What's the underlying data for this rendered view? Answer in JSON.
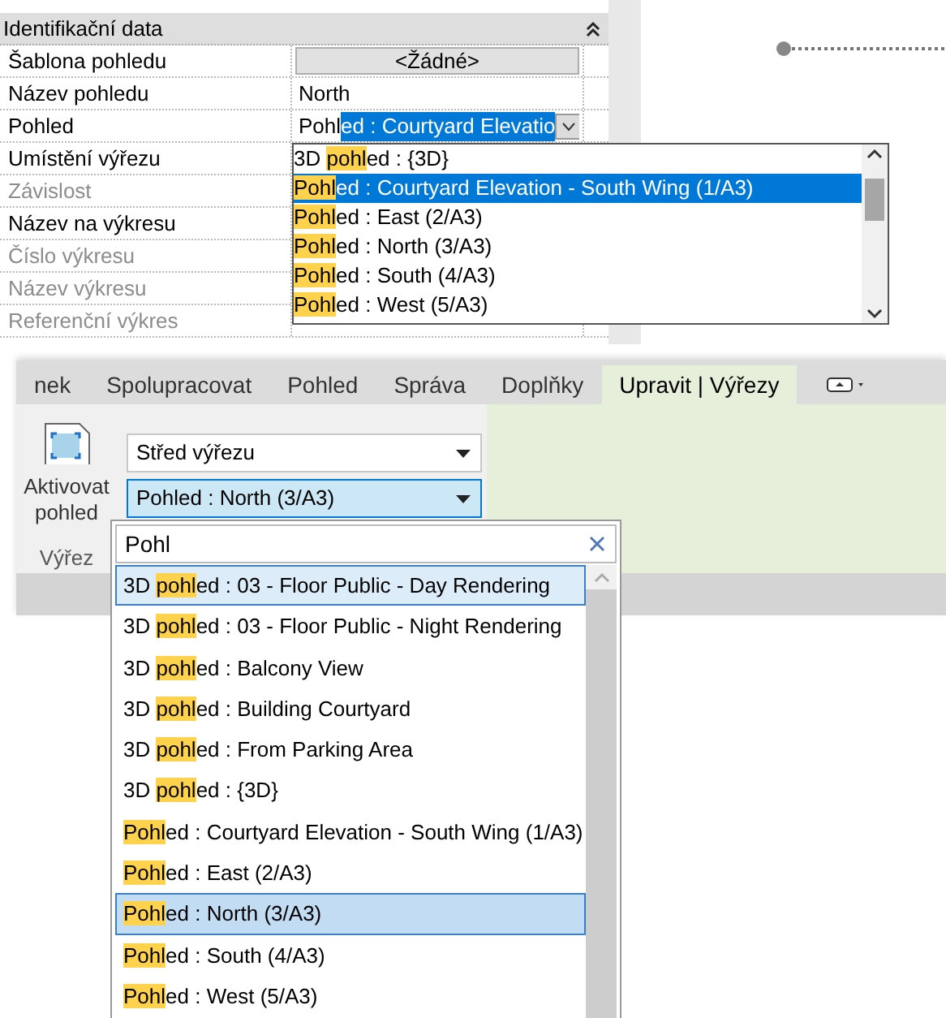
{
  "properties": {
    "section_title": "Identifikační data",
    "expanded": true,
    "rows": [
      {
        "label": "Šablona pohledu",
        "kind": "button",
        "value": "<Žádné>",
        "disabled": false
      },
      {
        "label": "Název pohledu",
        "kind": "text",
        "value": "North",
        "disabled": false
      },
      {
        "label": "Pohled",
        "kind": "combo",
        "value_before": "Pohl",
        "value_selected": "ed : Courtyard Elevatio",
        "disabled": false
      },
      {
        "label": "Umístění výřezu",
        "kind": "empty",
        "disabled": false
      },
      {
        "label": "Závislost",
        "kind": "empty",
        "disabled": true
      },
      {
        "label": "Název na výkresu",
        "kind": "empty",
        "disabled": false
      },
      {
        "label": "Číslo výkresu",
        "kind": "empty",
        "disabled": true
      },
      {
        "label": "Název výkresu",
        "kind": "empty",
        "disabled": true
      },
      {
        "label": "Referenční výkres",
        "kind": "empty",
        "disabled": true
      }
    ]
  },
  "property_dropdown": {
    "items": [
      {
        "before": "3D ",
        "match": "pohl",
        "after": "ed : {3D}",
        "selected": false
      },
      {
        "match": "Pohl",
        "after": "ed : Courtyard Elevation - South Wing (1/A3)",
        "selected": true
      },
      {
        "match": "Pohl",
        "after": "ed : East (2/A3)",
        "selected": false
      },
      {
        "match": "Pohl",
        "after": "ed : North (3/A3)",
        "selected": false
      },
      {
        "match": "Pohl",
        "after": "ed : South (4/A3)",
        "selected": false
      },
      {
        "match": "Pohl",
        "after": "ed : West (5/A3)",
        "selected": false
      }
    ]
  },
  "ribbon": {
    "tabs": [
      {
        "label": "nek",
        "selected": false
      },
      {
        "label": "Spolupracovat",
        "selected": false
      },
      {
        "label": "Pohled",
        "selected": false
      },
      {
        "label": "Správa",
        "selected": false
      },
      {
        "label": "Doplňky",
        "selected": false
      },
      {
        "label": "Upravit | Výřezy",
        "selected": true
      }
    ],
    "activate_label": "Aktivovat pohled",
    "panel_title": "Výřez",
    "combos": [
      {
        "value": "Střed výřezu",
        "focused": false
      },
      {
        "value": "Pohled : North (3/A3)",
        "focused": true
      }
    ]
  },
  "view_dropdown": {
    "search": "Pohl",
    "items": [
      {
        "before": "3D ",
        "match": "pohl",
        "after": "ed : 03 - Floor Public - Day Rendering",
        "selected": false,
        "hovered": true
      },
      {
        "before": "3D ",
        "match": "pohl",
        "after": "ed : 03 - Floor Public - Night Rendering",
        "selected": false,
        "hovered": false
      },
      {
        "before": "3D ",
        "match": "pohl",
        "after": "ed : Balcony View",
        "selected": false,
        "hovered": false
      },
      {
        "before": "3D ",
        "match": "pohl",
        "after": "ed : Building Courtyard",
        "selected": false,
        "hovered": false
      },
      {
        "before": "3D ",
        "match": "pohl",
        "after": "ed : From Parking Area",
        "selected": false,
        "hovered": false
      },
      {
        "before": "3D ",
        "match": "pohl",
        "after": "ed : {3D}",
        "selected": false,
        "hovered": false
      },
      {
        "match": "Pohl",
        "after": "ed : Courtyard Elevation - South Wing (1/A3)",
        "selected": false,
        "hovered": false
      },
      {
        "match": "Pohl",
        "after": "ed : East (2/A3)",
        "selected": false,
        "hovered": false
      },
      {
        "match": "Pohl",
        "after": "ed : North (3/A3)",
        "selected": true,
        "hovered": false
      },
      {
        "match": "Pohl",
        "after": "ed : South (4/A3)",
        "selected": false,
        "hovered": false
      },
      {
        "match": "Pohl",
        "after": "ed : West (5/A3)",
        "selected": false,
        "hovered": false
      }
    ]
  }
}
